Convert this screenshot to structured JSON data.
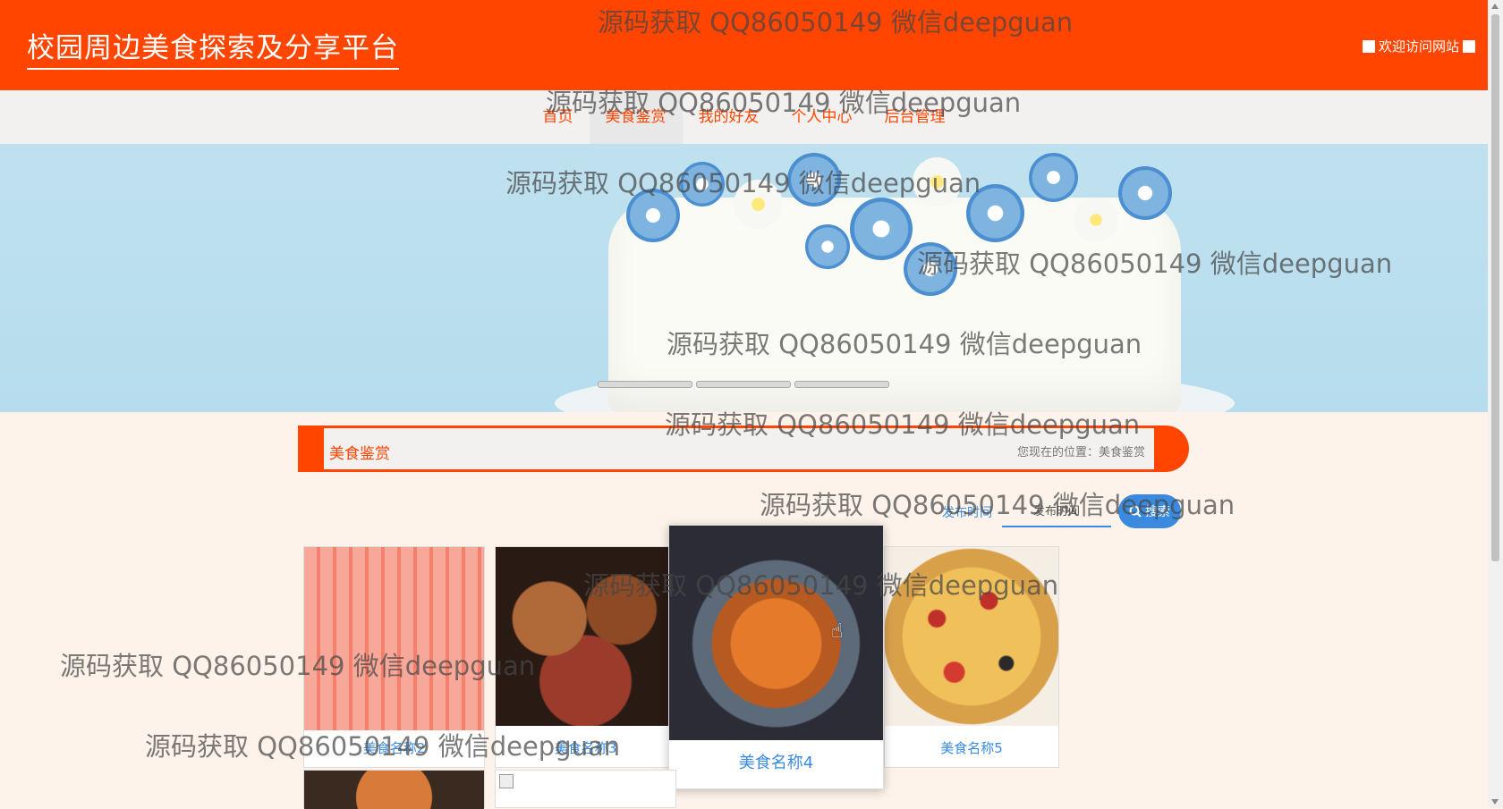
{
  "header": {
    "site_title": "校园周边美食探索及分享平台",
    "welcome": "欢迎访问网站"
  },
  "nav": {
    "items": [
      {
        "label": "首页",
        "active": false
      },
      {
        "label": "美食鉴赏",
        "active": true
      },
      {
        "label": "我的好友",
        "active": false
      },
      {
        "label": "个人中心",
        "active": false
      },
      {
        "label": "后台管理",
        "active": false
      }
    ]
  },
  "banner": {
    "slide_count": 3
  },
  "section": {
    "title": "美食鉴赏",
    "breadcrumb": "您现在的位置：美食鉴赏"
  },
  "search": {
    "label": "发布时间",
    "placeholder": "发布时间",
    "button_label": "搜索"
  },
  "cards": [
    {
      "name": "美食名称2"
    },
    {
      "name": "美食名称3"
    },
    {
      "name": "美食名称4"
    },
    {
      "name": "美食名称5"
    }
  ],
  "watermark": "源码获取 QQ86050149 微信deepguan",
  "colors": {
    "primary": "#ff4500",
    "link": "#3a8be0",
    "page_bg": "#fdf3ea"
  }
}
